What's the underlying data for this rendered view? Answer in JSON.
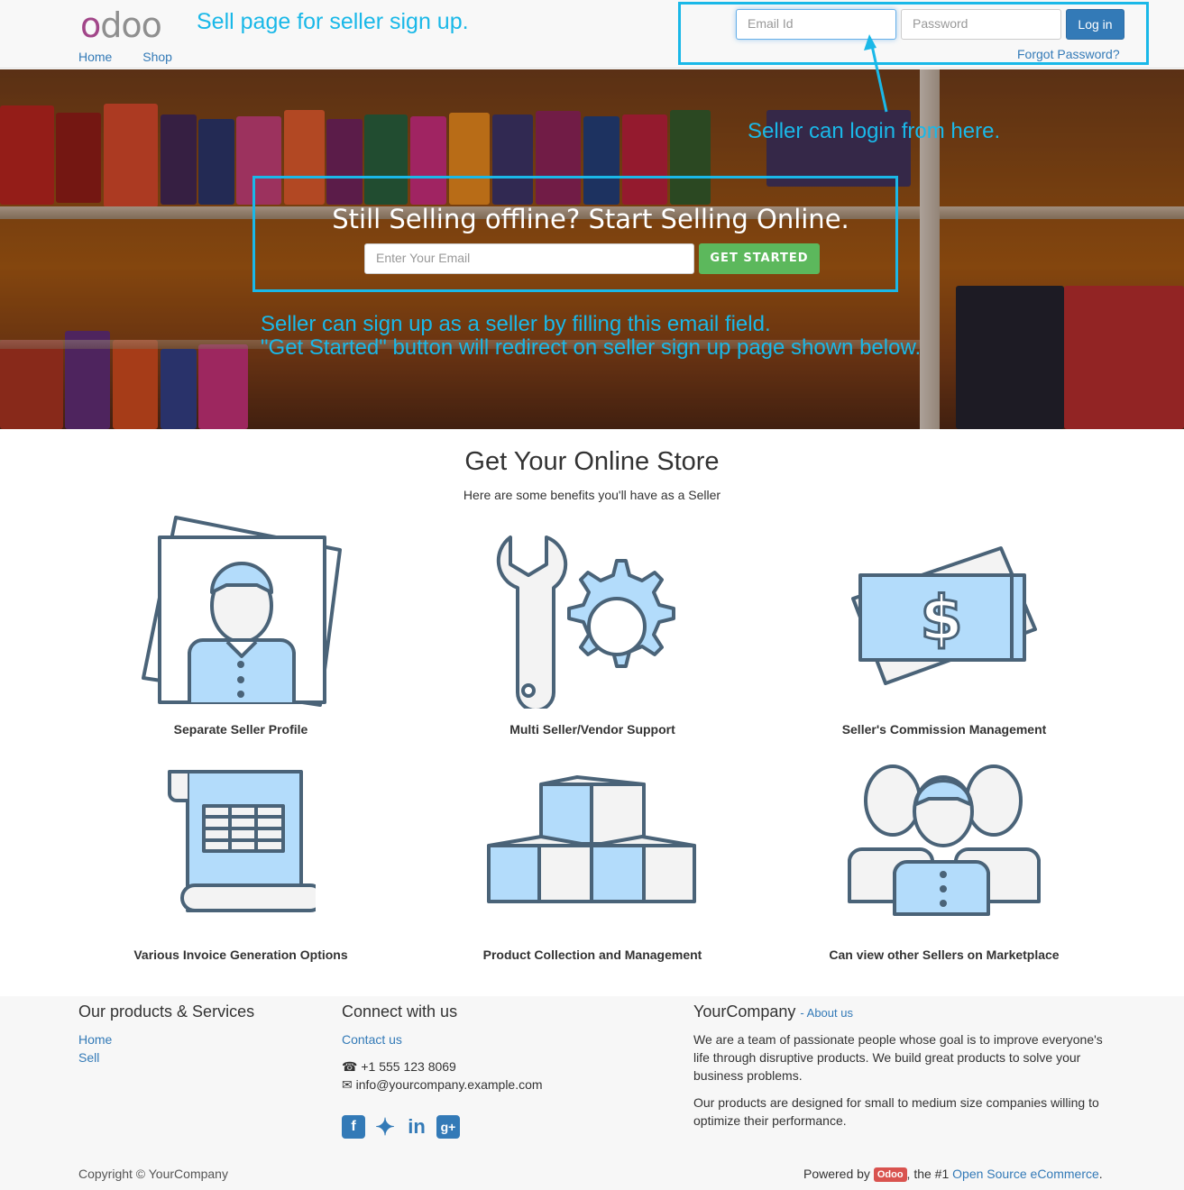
{
  "header": {
    "logo": "odoo",
    "annotation": "Sell page for seller sign up.",
    "nav": [
      "Home",
      "Shop"
    ],
    "login": {
      "email_placeholder": "Email Id",
      "password_placeholder": "Password",
      "login_label": "Log in",
      "forgot_label": "Forgot Password?"
    },
    "login_annotation": "Seller can login from here."
  },
  "hero": {
    "title": "Still Selling offline? Start Selling Online.",
    "email_placeholder": "Enter Your Email",
    "button_label": "GET STARTED",
    "annotation_line1": "Seller can sign up as a seller by filling this email field.",
    "annotation_line2": "\"Get Started\" button will redirect on seller sign up page shown below."
  },
  "benefits": {
    "title": "Get Your Online Store",
    "subtitle": "Here are some benefits you'll have as a Seller",
    "items": [
      {
        "label": "Separate Seller Profile",
        "icon": "seller-profile-icon"
      },
      {
        "label": "Multi Seller/Vendor Support",
        "icon": "wrench-gear-icon"
      },
      {
        "label": "Seller's Commission Management",
        "icon": "dollar-bill-icon"
      },
      {
        "label": "Various Invoice Generation Options",
        "icon": "invoice-scroll-icon"
      },
      {
        "label": "Product Collection and Management",
        "icon": "boxes-icon"
      },
      {
        "label": "Can view other Sellers on Marketplace",
        "icon": "sellers-group-icon"
      }
    ]
  },
  "footer": {
    "products": {
      "title": "Our products & Services",
      "links": [
        "Home",
        "Sell"
      ]
    },
    "connect": {
      "title": "Connect with us",
      "contact_label": "Contact us",
      "phone": "+1 555 123 8069",
      "email": "info@yourcompany.example.com",
      "social": [
        "facebook-icon",
        "twitter-icon",
        "linkedin-icon",
        "google-plus-icon"
      ]
    },
    "company": {
      "name": "YourCompany",
      "about_label": "- About us",
      "para1": "We are a team of passionate people whose goal is to improve everyone's life through disruptive products. We build great products to solve your business problems.",
      "para2": "Our products are designed for small to medium size companies willing to optimize their performance."
    },
    "copyright": "Copyright © YourCompany",
    "powered_prefix": "Powered by",
    "powered_badge": "Odoo",
    "powered_mid": ", the #1",
    "powered_link": "Open Source eCommerce",
    "powered_suffix": "."
  },
  "colors": {
    "annotation": "#1ab8e8",
    "link": "#337ab7",
    "button_primary": "#337ab7",
    "button_success": "#5cb85c",
    "icon_fill": "#b3dcfb",
    "icon_stroke": "#4a6378"
  }
}
